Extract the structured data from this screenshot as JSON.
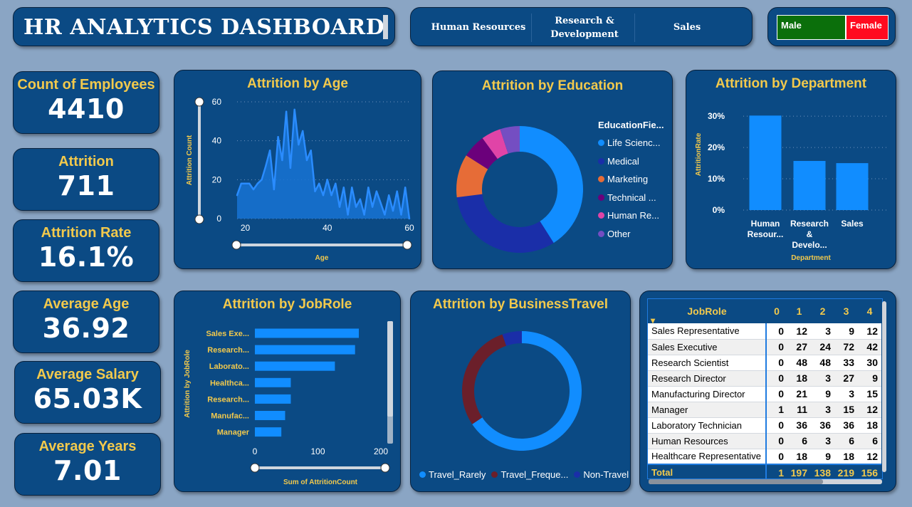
{
  "header": {
    "title": "HR ANALYTICS DASHBOARD"
  },
  "department_slicer": [
    "Human Resources",
    "Research & Development",
    "Sales"
  ],
  "gender_slicer": {
    "male": "Male",
    "female": "Female",
    "male_color": "#0b6f0b",
    "female_color": "#ff0a1f"
  },
  "kpis": [
    {
      "label": "Count of Employees",
      "value": "4410"
    },
    {
      "label": "Attrition",
      "value": "711"
    },
    {
      "label": "Attrition Rate",
      "value": "16.1%"
    },
    {
      "label": "Average Age",
      "value": "36.92"
    },
    {
      "label": "Average Salary",
      "value": "65.03K"
    },
    {
      "label": "Average Years",
      "value": "7.01"
    }
  ],
  "charts": {
    "age": {
      "type": "area",
      "title": "Attrition by Age",
      "xlabel": "Age",
      "ylabel": "Attrition Count",
      "xlim": [
        18,
        60
      ],
      "ylim": [
        0,
        60
      ],
      "xticks": [
        20,
        40,
        60
      ],
      "yticks": [
        0,
        20,
        40,
        60
      ],
      "x": [
        18,
        19,
        20,
        21,
        22,
        23,
        24,
        25,
        26,
        27,
        28,
        29,
        30,
        31,
        32,
        33,
        34,
        35,
        36,
        37,
        38,
        39,
        40,
        41,
        42,
        43,
        44,
        45,
        46,
        47,
        48,
        49,
        50,
        51,
        52,
        53,
        54,
        55,
        56,
        57,
        58,
        59,
        60
      ],
      "values": [
        12,
        18,
        18,
        18,
        15,
        18,
        20,
        27,
        35,
        15,
        42,
        30,
        55,
        26,
        56,
        38,
        45,
        30,
        35,
        14,
        18,
        12,
        20,
        12,
        18,
        6,
        16,
        2,
        16,
        6,
        10,
        2,
        16,
        6,
        14,
        8,
        2,
        12,
        4,
        14,
        2,
        16,
        0
      ]
    },
    "education": {
      "type": "pie",
      "title": "Attrition by Education",
      "legend_title": "EducationFie...",
      "labels": [
        "Life Scienc...",
        "Medical",
        "Marketing",
        "Technical ...",
        "Human Re...",
        "Other"
      ],
      "values": [
        41,
        32,
        11,
        6,
        5,
        5
      ],
      "colors": [
        "#118dff",
        "#1a2ea8",
        "#e66c37",
        "#6b007b",
        "#e044a7",
        "#744ec2"
      ]
    },
    "department": {
      "type": "bar",
      "title": "Attrition by Department",
      "xlabel": "Department",
      "ylabel": "AttritionRate",
      "categories": [
        "Human Resour...",
        "Research & Develo...",
        "Sales"
      ],
      "category_lines": [
        [
          "Human",
          "Resour..."
        ],
        [
          "Research",
          "&",
          "Develo..."
        ],
        [
          "Sales"
        ]
      ],
      "values": [
        30.2,
        15.7,
        15.0
      ],
      "yticks": [
        "0%",
        "10%",
        "20%",
        "30%"
      ],
      "ylim": [
        0,
        33
      ]
    },
    "jobrole": {
      "type": "bar",
      "title": "Attrition by JobRole",
      "xlabel": "Sum of AttritionCount",
      "ylabel": "Attrition by JobRole",
      "categories": [
        "Sales Exe...",
        "Research...",
        "Laborato...",
        "Healthca...",
        "Research...",
        "Manufac...",
        "Manager"
      ],
      "values": [
        165,
        159,
        127,
        57,
        57,
        48,
        42
      ],
      "xticks": [
        0,
        100,
        200
      ],
      "xlim": [
        0,
        200
      ]
    },
    "travel": {
      "type": "pie",
      "title": "Attrition by BusinessTravel",
      "labels": [
        "Travel_Rarely",
        "Travel_Freque...",
        "Non-Travel"
      ],
      "values": [
        65.6,
        29.1,
        5.3
      ],
      "colors": [
        "#118dff",
        "#6b1f2a",
        "#1a2ea8"
      ]
    }
  },
  "matrix": {
    "corner": "JobRole",
    "columns": [
      "0",
      "1",
      "2",
      "3",
      "4"
    ],
    "rows": [
      {
        "role": "Sales Representative",
        "vals": [
          "0",
          "12",
          "3",
          "9",
          "12"
        ]
      },
      {
        "role": "Sales Executive",
        "vals": [
          "0",
          "27",
          "24",
          "72",
          "42"
        ]
      },
      {
        "role": "Research Scientist",
        "vals": [
          "0",
          "48",
          "48",
          "33",
          "30"
        ]
      },
      {
        "role": "Research Director",
        "vals": [
          "0",
          "18",
          "3",
          "27",
          "9"
        ]
      },
      {
        "role": "Manufacturing Director",
        "vals": [
          "0",
          "21",
          "9",
          "3",
          "15"
        ]
      },
      {
        "role": "Manager",
        "vals": [
          "1",
          "11",
          "3",
          "15",
          "12"
        ]
      },
      {
        "role": "Laboratory Technician",
        "vals": [
          "0",
          "36",
          "36",
          "36",
          "18"
        ]
      },
      {
        "role": "Human Resources",
        "vals": [
          "0",
          "6",
          "3",
          "6",
          "6"
        ]
      },
      {
        "role": "Healthcare Representative",
        "vals": [
          "0",
          "18",
          "9",
          "18",
          "12"
        ]
      }
    ],
    "total": {
      "label": "Total",
      "vals": [
        "1",
        "197",
        "138",
        "219",
        "156"
      ]
    }
  }
}
